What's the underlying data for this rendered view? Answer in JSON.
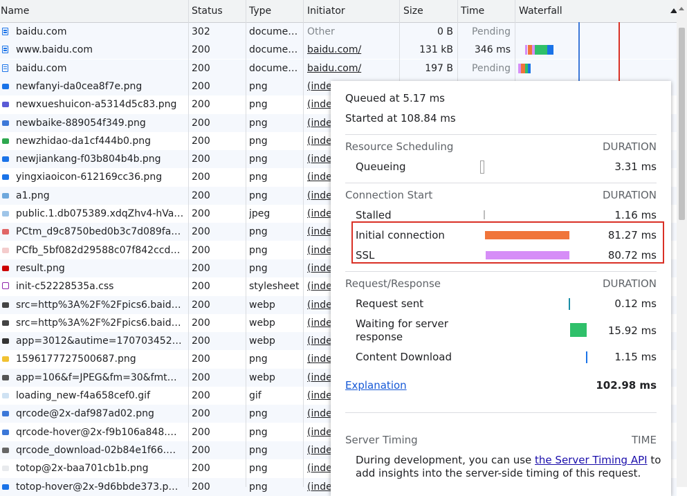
{
  "columns": {
    "name": "Name",
    "status": "Status",
    "type": "Type",
    "initiator": "Initiator",
    "size": "Size",
    "time": "Time",
    "waterfall": "Waterfall"
  },
  "rows": [
    {
      "name": "baidu.com",
      "status": "302",
      "type": "docume…",
      "initiator": "Other",
      "size": "0 B",
      "time": "Pending",
      "icon": "document-icon"
    },
    {
      "name": "www.baidu.com",
      "status": "200",
      "type": "docume…",
      "initiator": "baidu.com/",
      "size": "131 kB",
      "time": "346 ms",
      "icon": "document-icon"
    },
    {
      "name": "baidu.com",
      "status": "200",
      "type": "docume…",
      "initiator": "baidu.com/",
      "size": "197 B",
      "time": "Pending",
      "icon": "document-icon"
    },
    {
      "name": "newfanyi-da0cea8f7e.png",
      "status": "200",
      "type": "png",
      "initiator": "(inde",
      "icon": "image-icon"
    },
    {
      "name": "newxueshuicon-a5314d5c83.png",
      "status": "200",
      "type": "png",
      "initiator": "(inde",
      "icon": "image-icon"
    },
    {
      "name": "newbaike-889054f349.png",
      "status": "200",
      "type": "png",
      "initiator": "(inde",
      "icon": "image-icon"
    },
    {
      "name": "newzhidao-da1cf444b0.png",
      "status": "200",
      "type": "png",
      "initiator": "(inde",
      "icon": "image-icon"
    },
    {
      "name": "newjiankang-f03b804b4b.png",
      "status": "200",
      "type": "png",
      "initiator": "(inde",
      "icon": "image-icon"
    },
    {
      "name": "yingxiaoicon-612169cc36.png",
      "status": "200",
      "type": "png",
      "initiator": "(inde",
      "icon": "image-icon"
    },
    {
      "name": "a1.png",
      "status": "200",
      "type": "png",
      "initiator": "(inde",
      "icon": "image-icon"
    },
    {
      "name": "public.1.db075389.xdqZhv4-hVa…",
      "status": "200",
      "type": "jpeg",
      "initiator": "(inde",
      "icon": "image-icon"
    },
    {
      "name": "PCtm_d9c8750bed0b3c7d089fa…",
      "status": "200",
      "type": "png",
      "initiator": "(inde",
      "icon": "image-icon"
    },
    {
      "name": "PCfb_5bf082d29588c07f842ccd…",
      "status": "200",
      "type": "png",
      "initiator": "(inde",
      "icon": "image-icon"
    },
    {
      "name": "result.png",
      "status": "200",
      "type": "png",
      "initiator": "(inde",
      "icon": "image-icon"
    },
    {
      "name": "init-c52228535a.css",
      "status": "200",
      "type": "stylesheet",
      "initiator": "(inde",
      "icon": "stylesheet-icon"
    },
    {
      "name": "src=http%3A%2F%2Fpics6.baid…",
      "status": "200",
      "type": "webp",
      "initiator": "(inde",
      "icon": "image-icon"
    },
    {
      "name": "src=http%3A%2F%2Fpics6.baid…",
      "status": "200",
      "type": "webp",
      "initiator": "(inde",
      "icon": "image-icon"
    },
    {
      "name": "app=3012&autime=170703452…",
      "status": "200",
      "type": "webp",
      "initiator": "(inde",
      "icon": "image-icon"
    },
    {
      "name": "1596177727500687.png",
      "status": "200",
      "type": "png",
      "initiator": "(inde",
      "icon": "image-icon"
    },
    {
      "name": "app=106&f=JPEG&fm=30&fmt…",
      "status": "200",
      "type": "webp",
      "initiator": "(inde",
      "icon": "image-icon"
    },
    {
      "name": "loading_new-f4a658cef0.gif",
      "status": "200",
      "type": "gif",
      "initiator": "(inde",
      "icon": "image-icon"
    },
    {
      "name": "qrcode@2x-daf987ad02.png",
      "status": "200",
      "type": "png",
      "initiator": "(inde",
      "icon": "image-icon"
    },
    {
      "name": "qrcode-hover@2x-f9b106a848.…",
      "status": "200",
      "type": "png",
      "initiator": "(inde",
      "icon": "image-icon"
    },
    {
      "name": "qrcode_download-02b84e1f66.…",
      "status": "200",
      "type": "png",
      "initiator": "(inde",
      "icon": "image-icon"
    },
    {
      "name": "totop@2x-baa701cb1b.png",
      "status": "200",
      "type": "png",
      "initiator": "(inde",
      "icon": "image-icon"
    },
    {
      "name": "totop-hover@2x-9d6bbde373.p…",
      "status": "200",
      "type": "png",
      "initiator": "(inde",
      "icon": "image-icon"
    }
  ],
  "timing": {
    "queued_at": "Queued at 5.17 ms",
    "started_at": "Started at 108.84 ms",
    "duration_label": "DURATION",
    "resource_scheduling": {
      "title": "Resource Scheduling",
      "items": [
        {
          "label": "Queueing",
          "value": "3.31 ms",
          "color": "#ffffff"
        }
      ]
    },
    "connection_start": {
      "title": "Connection Start",
      "items": [
        {
          "label": "Stalled",
          "value": "1.16 ms",
          "color": "#bdbdbd"
        },
        {
          "label": "Initial connection",
          "value": "81.27 ms",
          "color": "#f0753a"
        },
        {
          "label": "SSL",
          "value": "80.72 ms",
          "color": "#d68ef7"
        }
      ]
    },
    "request_response": {
      "title": "Request/Response",
      "items": [
        {
          "label": "Request sent",
          "value": "0.12 ms",
          "color": "#1a8ea6"
        },
        {
          "label": "Waiting for server response",
          "label_line1": "Waiting for server",
          "label_line2": "response",
          "value": "15.92 ms",
          "color": "#2fc06a"
        },
        {
          "label": "Content Download",
          "value": "1.15 ms",
          "color": "#1a73e8"
        }
      ]
    },
    "explanation": "Explanation",
    "total": "102.98 ms",
    "server_timing": {
      "title": "Server Timing",
      "time_label": "TIME",
      "text_before": "During development, you can use ",
      "link": "the Server Timing API",
      "text_after": " to",
      "line2": "add insights into the server-side timing of this request."
    }
  }
}
